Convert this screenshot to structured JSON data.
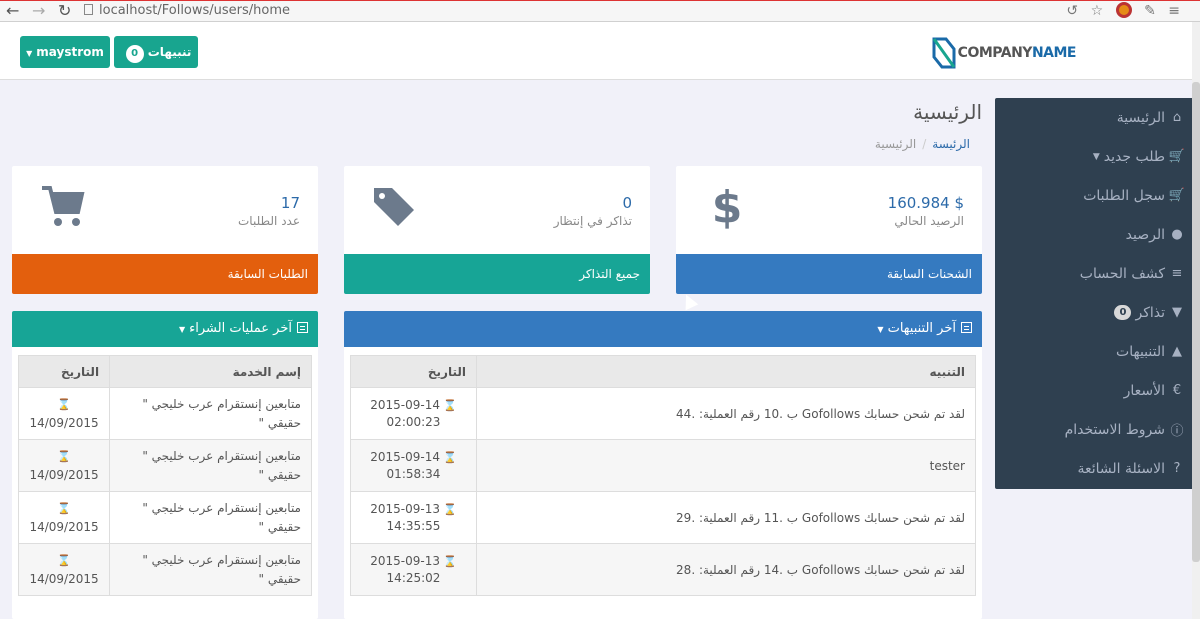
{
  "browser": {
    "url": "localhost/Follows/users/home"
  },
  "header": {
    "user_button": "maystrom",
    "notifications_label": "تنبيهات",
    "notifications_count": "0",
    "logo_text_1": "COMPANY",
    "logo_text_2": "NAME"
  },
  "sidebar": {
    "items": [
      {
        "label": "الرئيسية",
        "icon": "home-icon"
      },
      {
        "label": "طلب جديد",
        "icon": "cart-icon"
      },
      {
        "label": "سجل الطلبات",
        "icon": "cart-icon"
      },
      {
        "label": "الرصيد",
        "icon": "piggy-bank-icon"
      },
      {
        "label": "كشف الحساب",
        "icon": "sort-icon"
      },
      {
        "label": "تذاكر",
        "icon": "tag-icon",
        "badge": "0"
      },
      {
        "label": "التنبيهات",
        "icon": "bell-icon"
      },
      {
        "label": "الأسعار",
        "icon": "euro-icon"
      },
      {
        "label": "شروط الاستخدام",
        "icon": "info-icon"
      },
      {
        "label": "الاسئلة الشائعة",
        "icon": "question-icon"
      }
    ]
  },
  "page": {
    "title": "الرئيسية",
    "breadcrumb_home": "الرئيسة",
    "breadcrumb_current": "الرئيسية"
  },
  "cards": [
    {
      "value": "$ 160.984",
      "label": "الرصيد الحالي",
      "footer": "الشحنات السابقة",
      "icon": "dollar-icon"
    },
    {
      "value": "0",
      "label": "تذاكر في إنتظار",
      "footer": "جميع التذاكر",
      "icon": "tags-icon"
    },
    {
      "value": "17",
      "label": "عدد الطلبات",
      "footer": "الطلبات السابقة",
      "icon": "cart-icon"
    }
  ],
  "notifications_panel": {
    "title": "آخر التنبيهات",
    "col_notice": "التنبيه",
    "col_date": "التاريخ",
    "rows": [
      {
        "text": "لقد تم شحن حسابك Gofollows ب .10 رقم العملية: .44",
        "date": "2015-09-14",
        "time": "02:00:23"
      },
      {
        "text": "tester",
        "date": "2015-09-14",
        "time": "01:58:34"
      },
      {
        "text": "لقد تم شحن حسابك Gofollows ب .11 رقم العملية: .29",
        "date": "2015-09-13",
        "time": "14:35:55"
      },
      {
        "text": "لقد تم شحن حسابك Gofollows ب .14 رقم العملية: .28",
        "date": "2015-09-13",
        "time": "14:25:02"
      }
    ]
  },
  "orders_panel": {
    "title": "آخر عمليات الشراء",
    "col_service": "إسم الخدمة",
    "col_date": "التاريخ",
    "rows": [
      {
        "service": "متابعين إنستقرام عرب خليجي \" حقيقي \"",
        "date": "14/09/2015"
      },
      {
        "service": "متابعين إنستقرام عرب خليجي \" حقيقي \"",
        "date": "14/09/2015"
      },
      {
        "service": "متابعين إنستقرام عرب خليجي \" حقيقي \"",
        "date": "14/09/2015"
      },
      {
        "service": "متابعين إنستقرام عرب خليجي \" حقيقي \"",
        "date": "14/09/2015"
      }
    ]
  }
}
